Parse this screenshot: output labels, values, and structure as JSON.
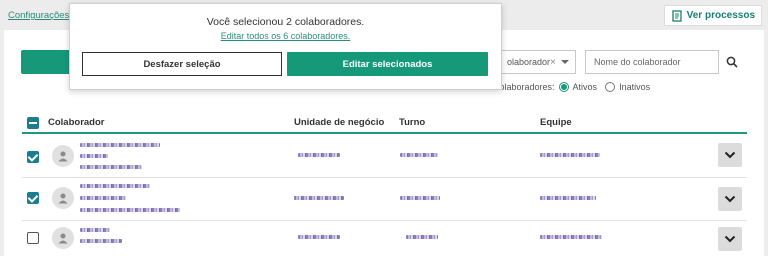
{
  "breadcrumb": "Configurações",
  "header": {
    "ver_processos_label": "Ver processos"
  },
  "filters": {
    "team_select_value": "olaborador",
    "clear_symbol": "×",
    "search_placeholder": "Nome do colaborador",
    "show_label": "Exibir colaboradores:",
    "options": [
      "Ativos",
      "Inativos"
    ],
    "selected_option": "Ativos"
  },
  "table": {
    "columns": [
      "Colaborador",
      "Unidade de negócio",
      "Turno",
      "Equipe"
    ],
    "rows": [
      {
        "checked": true
      },
      {
        "checked": true
      },
      {
        "checked": false
      }
    ]
  },
  "popup": {
    "message": "Você selecionou 2 colaboradores.",
    "edit_all_link": "Editar todos os 6 colaboradores.",
    "undo_button": "Desfazer seleção",
    "edit_selected_button": "Editar selecionados"
  },
  "colors": {
    "accent": "#159979",
    "checkbox": "#1b7d8e",
    "link": "#2b8a7b"
  },
  "icons": [
    "document-icon",
    "search-icon",
    "user-icon",
    "chevron-down-icon",
    "close-icon"
  ]
}
